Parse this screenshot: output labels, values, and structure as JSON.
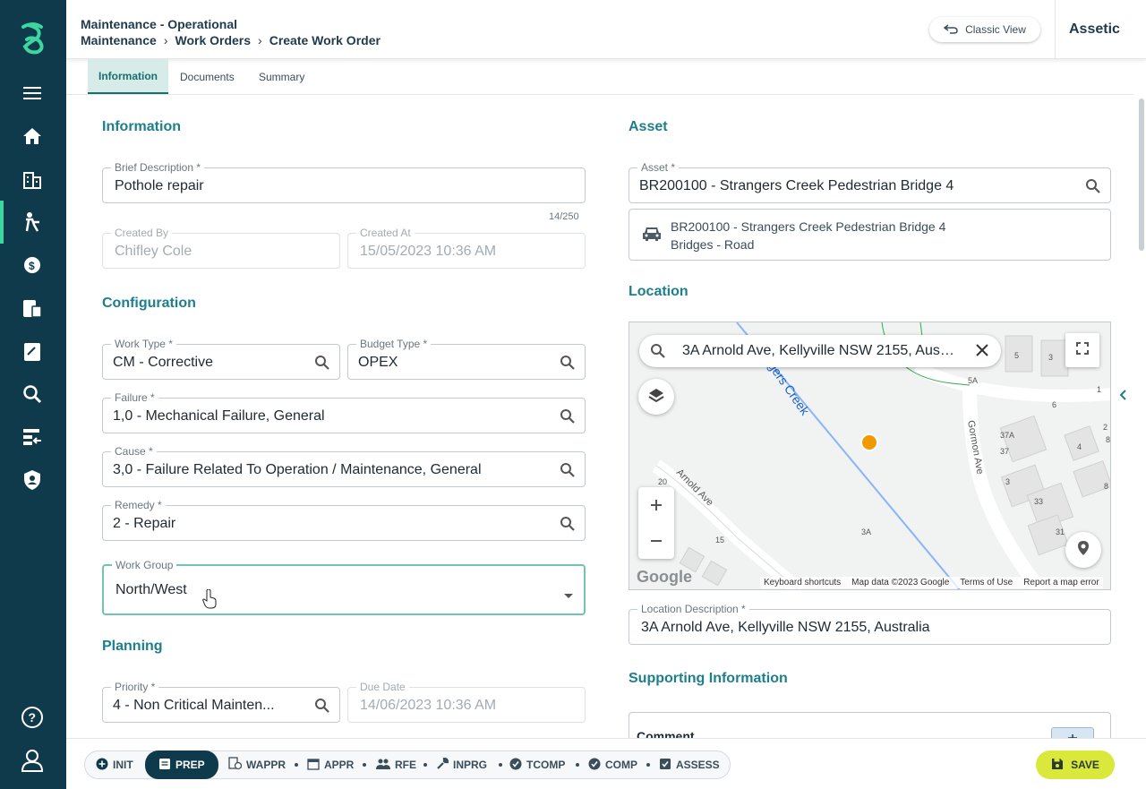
{
  "header": {
    "title": "Maintenance - Operational",
    "breadcrumb": [
      "Maintenance",
      "Work Orders",
      "Create Work Order"
    ],
    "classic_view_label": "Classic View",
    "brand": "Assetic"
  },
  "tabs": [
    {
      "label": "Information",
      "active": true
    },
    {
      "label": "Documents",
      "active": false
    },
    {
      "label": "Summary",
      "active": false
    }
  ],
  "information": {
    "title": "Information",
    "brief_description": {
      "label": "Brief Description *",
      "value": "Pothole repair",
      "count": "14/250"
    },
    "created_by": {
      "label": "Created By",
      "value": "Chifley Cole"
    },
    "created_at": {
      "label": "Created At",
      "value": "15/05/2023 10:36 AM"
    }
  },
  "configuration": {
    "title": "Configuration",
    "work_type": {
      "label": "Work Type *",
      "value": "CM - Corrective"
    },
    "budget_type": {
      "label": "Budget Type *",
      "value": "OPEX"
    },
    "failure": {
      "label": "Failure *",
      "value": "1,0 - Mechanical Failure, General"
    },
    "cause": {
      "label": "Cause *",
      "value": "3,0 - Failure Related To Operation / Maintenance, General"
    },
    "remedy": {
      "label": "Remedy *",
      "value": "2 - Repair"
    },
    "work_group": {
      "label": "Work Group",
      "value": "North/West"
    }
  },
  "planning": {
    "title": "Planning",
    "priority": {
      "label": "Priority *",
      "value": "4 - Non Critical Mainten..."
    },
    "due_date": {
      "label": "Due Date",
      "value": "14/06/2023 10:36 AM"
    }
  },
  "asset": {
    "title": "Asset",
    "field": {
      "label": "Asset *",
      "value": "BR200100 - Strangers Creek Pedestrian Bridge 4"
    },
    "card_line1": "BR200100 - Strangers Creek Pedestrian Bridge 4",
    "card_line2": "Bridges - Road"
  },
  "location": {
    "title": "Location",
    "map_search": "3A Arnold Ave, Kellyville NSW 2155, Australia",
    "map_labels": {
      "creek": "ngers Creek",
      "arnold": "Arnold Ave",
      "gormon": "Gormon Ave",
      "n20": "20",
      "n15": "15",
      "n3a": "3A",
      "n5": "5",
      "n3": "3",
      "n5a": "5A",
      "n1": "1",
      "n6": "6",
      "n2": "2",
      "n8": "8",
      "n37a": "37A",
      "n37": "37",
      "n4": "4",
      "n3b": "3",
      "n33": "33",
      "n31": "31",
      "n8b": "8"
    },
    "map_footer": [
      "Keyboard shortcuts",
      "Map data ©2023 Google",
      "Terms of Use",
      "Report a map error"
    ],
    "google": "Google",
    "description": {
      "label": "Location Description *",
      "value": "3A Arnold Ave, Kellyville NSW 2155, Australia"
    }
  },
  "supporting": {
    "title": "Supporting Information",
    "comment_label": "Comment"
  },
  "status_steps": [
    {
      "label": "INIT",
      "icon": "plus-circle-icon"
    },
    {
      "label": "PREP",
      "icon": "note-icon",
      "active": true
    },
    {
      "label": "WAPPR",
      "icon": "doc-clock-icon"
    },
    {
      "label": "APPR",
      "icon": "calendar-icon"
    },
    {
      "label": "RFE",
      "icon": "people-icon"
    },
    {
      "label": "INPRG",
      "icon": "wrench-icon"
    },
    {
      "label": "TCOMP",
      "icon": "check-circle-icon"
    },
    {
      "label": "COMP",
      "icon": "check-circle-icon"
    },
    {
      "label": "ASSESS",
      "icon": "checkbox-icon"
    }
  ],
  "save_label": "SAVE",
  "colors": {
    "sidebar": "#0e3a4c",
    "accent": "#1d7f8c",
    "save": "#d9e83a",
    "active_tab": "#d7ebe9"
  }
}
